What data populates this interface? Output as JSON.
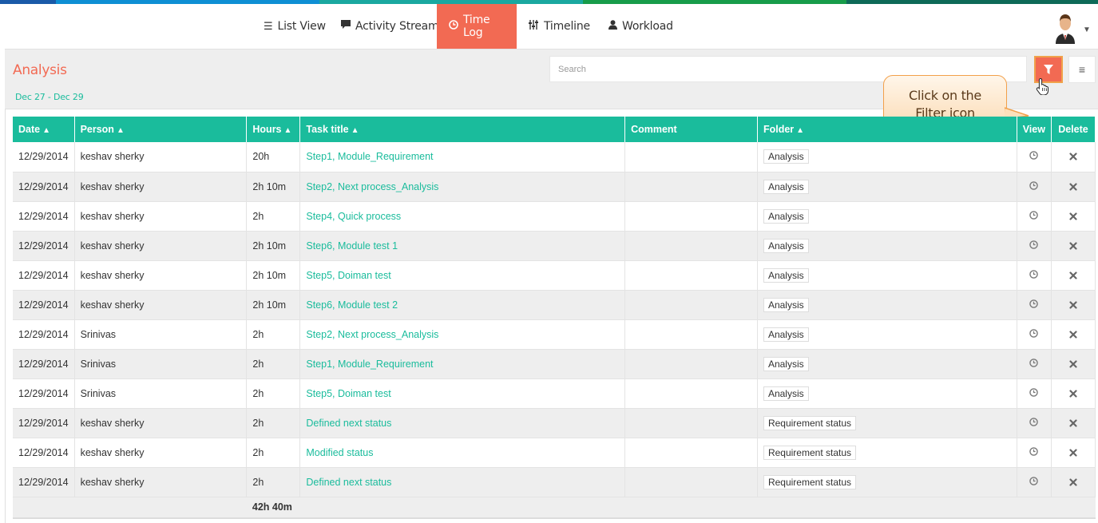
{
  "nav": {
    "items": [
      {
        "label": "List View",
        "icon": "list-icon"
      },
      {
        "label": "Activity Stream",
        "icon": "comment-icon"
      },
      {
        "label": "Time Log",
        "icon": "clock-icon",
        "active": true
      },
      {
        "label": "Timeline",
        "icon": "sliders-icon"
      },
      {
        "label": "Workload",
        "icon": "user-icon"
      }
    ]
  },
  "header": {
    "title": "Analysis",
    "date_range": "Dec 27  -  Dec 29",
    "search_placeholder": "Search"
  },
  "callout": {
    "line1": "Click on the",
    "line2": "Filter icon"
  },
  "table": {
    "columns": [
      "Date",
      "Person",
      "Hours",
      "Task title",
      "Comment",
      "Folder",
      "View",
      "Delete"
    ],
    "rows": [
      {
        "date": "12/29/2014",
        "person": "keshav sherky",
        "hours": "20h",
        "task": "Step1, Module_Requirement",
        "comment": "",
        "folder": "Analysis"
      },
      {
        "date": "12/29/2014",
        "person": "keshav sherky",
        "hours": "2h 10m",
        "task": "Step2, Next process_Analysis",
        "comment": "",
        "folder": "Analysis"
      },
      {
        "date": "12/29/2014",
        "person": "keshav sherky",
        "hours": "2h",
        "task": "Step4, Quick process",
        "comment": "",
        "folder": "Analysis"
      },
      {
        "date": "12/29/2014",
        "person": "keshav sherky",
        "hours": "2h 10m",
        "task": "Step6, Module test 1",
        "comment": "",
        "folder": "Analysis"
      },
      {
        "date": "12/29/2014",
        "person": "keshav sherky",
        "hours": "2h 10m",
        "task": "Step5, Doiman test",
        "comment": "",
        "folder": "Analysis"
      },
      {
        "date": "12/29/2014",
        "person": "keshav sherky",
        "hours": "2h 10m",
        "task": "Step6, Module test 2",
        "comment": "",
        "folder": "Analysis"
      },
      {
        "date": "12/29/2014",
        "person": "Srinivas",
        "hours": "2h",
        "task": "Step2, Next process_Analysis",
        "comment": "",
        "folder": "Analysis"
      },
      {
        "date": "12/29/2014",
        "person": "Srinivas",
        "hours": "2h",
        "task": "Step1, Module_Requirement",
        "comment": "",
        "folder": "Analysis"
      },
      {
        "date": "12/29/2014",
        "person": "Srinivas",
        "hours": "2h",
        "task": "Step5, Doiman test",
        "comment": "",
        "folder": "Analysis"
      },
      {
        "date": "12/29/2014",
        "person": "keshav sherky",
        "hours": "2h",
        "task": "Defined next status",
        "comment": "",
        "folder": "Requirement status"
      },
      {
        "date": "12/29/2014",
        "person": "keshav sherky",
        "hours": "2h",
        "task": "Modified status",
        "comment": "",
        "folder": "Requirement status"
      },
      {
        "date": "12/29/2014",
        "person": "keshav sherky",
        "hours": "2h",
        "task": "Defined next status",
        "comment": "",
        "folder": "Requirement status"
      }
    ],
    "total_hours": "42h 40m"
  },
  "colors": {
    "accent": "#f26a53",
    "teal": "#1abc9c",
    "stripe": [
      "#1a5aa8",
      "#0e8fd4",
      "#1aa8a0",
      "#179c4a",
      "#0e6a58"
    ]
  }
}
